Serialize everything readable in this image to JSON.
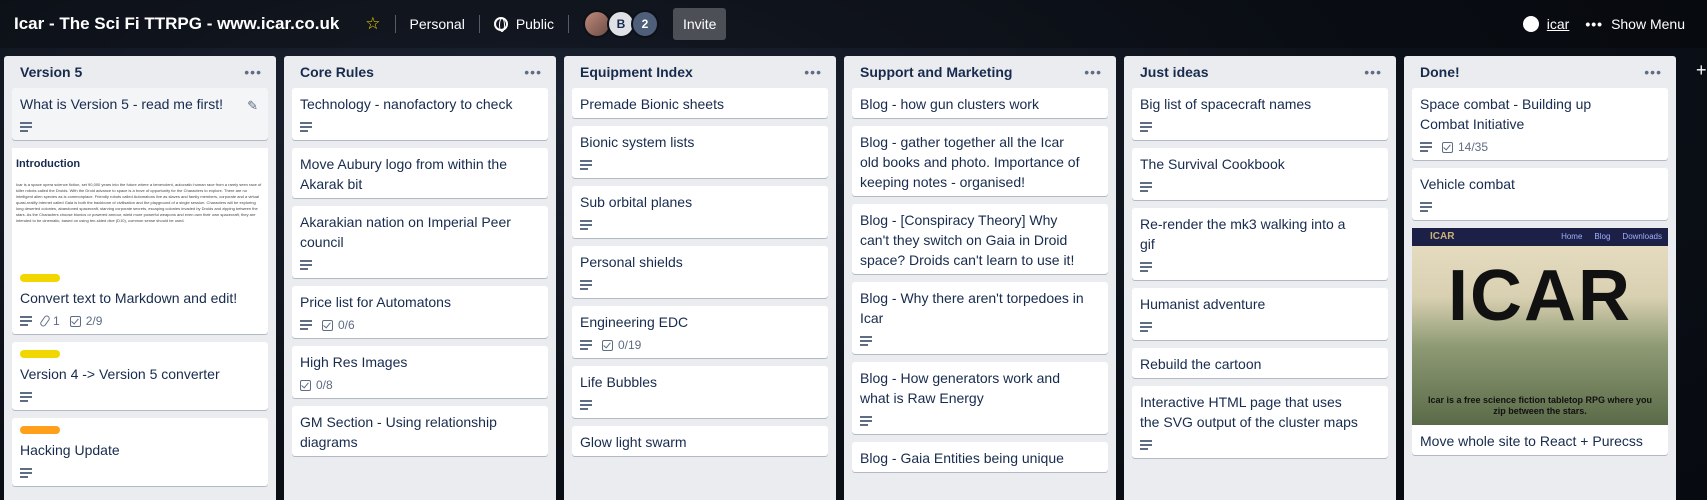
{
  "header": {
    "board_title": "Icar - The Sci Fi TTRPG - www.icar.co.uk",
    "workspace": "Personal",
    "visibility": "Public",
    "avatar_b": "B",
    "extra_members": "2",
    "invite": "Invite",
    "github_user": "icar",
    "show_menu": "Show Menu",
    "menu_dots": "•••"
  },
  "lists": [
    {
      "title": "Version 5",
      "cards": [
        {
          "title": "What is Version 5 - read me first!"
        },
        {
          "cover_heading": "Introduction",
          "cover_text": "Icar is a space opera science fiction, set 90,000 years into the future where a benevolent, autocratic human race from a rarely seen race of killer robots called the Droids. With the Droid advance to space is a trove of opportunity for the Characters to explore. There are no intelligent alien species as is commonplace. Friendly robots called Automatons live as slaves and family members, corporate and a virtual quasi-reality internet called Gaia is both the backbone of civilisation and the playground of a single session. Characters will be exploring long deserted colonies, abandoned spacecraft, starving corporate secrets, escaping colonies invaded by Droids and zipping between the stars. As the Characters choose bionics or powered armour, wield more powerful weapons and even own their own spacecraft, they are intended to be cinematic, based on using ten-sided dice (D10), common sense should be used.",
          "title": "Convert text to Markdown and edit!",
          "attachments": "1",
          "checklist": "2/9"
        },
        {
          "title": "Version 4 -> Version 5 converter"
        },
        {
          "title": "Hacking Update"
        }
      ]
    },
    {
      "title": "Core Rules",
      "cards": [
        {
          "title": "Technology - nanofactory to check"
        },
        {
          "title": "Move Aubury logo from within the Akarak bit"
        },
        {
          "title": "Akarakian nation on Imperial Peer council"
        },
        {
          "title": "Price list for Automatons",
          "checklist": "0/6"
        },
        {
          "title": "High Res Images",
          "checklist": "0/8"
        },
        {
          "title": "GM Section - Using relationship diagrams"
        }
      ]
    },
    {
      "title": "Equipment Index",
      "cards": [
        {
          "title": "Premade Bionic sheets"
        },
        {
          "title": "Bionic system lists"
        },
        {
          "title": "Sub orbital planes"
        },
        {
          "title": "Personal shields"
        },
        {
          "title": "Engineering EDC",
          "checklist": "0/19"
        },
        {
          "title": "Life Bubbles"
        },
        {
          "title": "Glow light swarm"
        }
      ]
    },
    {
      "title": "Support and Marketing",
      "cards": [
        {
          "title": "Blog - how gun clusters work"
        },
        {
          "title": "Blog - gather together all the Icar old books and photo. Importance of keeping notes - organised!"
        },
        {
          "title": "Blog - [Conspiracy Theory] Why can't they switch on Gaia in Droid space? Droids can't learn to use it!"
        },
        {
          "title": "Blog - Why there aren't torpedoes in Icar"
        },
        {
          "title": "Blog - How generators work and what is Raw Energy"
        },
        {
          "title": "Blog - Gaia Entities being unique"
        }
      ]
    },
    {
      "title": "Just ideas",
      "cards": [
        {
          "title": "Big list of spacecraft names"
        },
        {
          "title": "The Survival Cookbook"
        },
        {
          "title": "Re-render the mk3 walking into a gif"
        },
        {
          "title": "Humanist adventure"
        },
        {
          "title": "Rebuild the cartoon"
        },
        {
          "title": "Interactive HTML page that uses the SVG output of the cluster maps"
        }
      ]
    },
    {
      "title": "Done!",
      "cards": [
        {
          "title": "Space combat - Building up Combat Initiative",
          "checklist": "14/35"
        },
        {
          "title": "Vehicle combat"
        },
        {
          "cover_brand": "ICAR",
          "cover_nav": [
            "Home",
            "Blog",
            "Downloads"
          ],
          "cover_logo": "ICAR",
          "cover_tag": "Icar is a free science fiction tabletop RPG where you zip between the stars.",
          "title": "Move whole site to React + Purecss"
        }
      ]
    }
  ],
  "add_list": "+"
}
